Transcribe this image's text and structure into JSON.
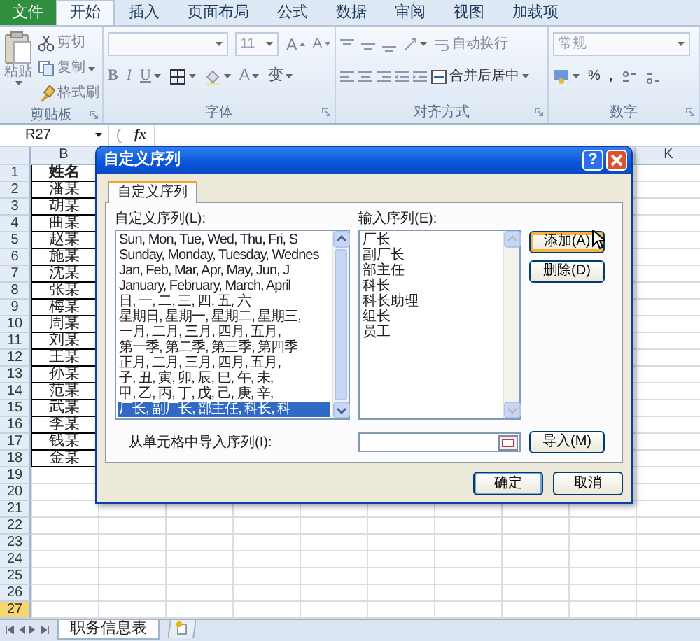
{
  "ribbon_tabs": [
    {
      "label": "文件",
      "kind": "file",
      "selected": false
    },
    {
      "label": "开始",
      "kind": "tab",
      "selected": true
    },
    {
      "label": "插入",
      "kind": "tab",
      "selected": false
    },
    {
      "label": "页面布局",
      "kind": "tab",
      "selected": false
    },
    {
      "label": "公式",
      "kind": "tab",
      "selected": false
    },
    {
      "label": "数据",
      "kind": "tab",
      "selected": false
    },
    {
      "label": "审阅",
      "kind": "tab",
      "selected": false
    },
    {
      "label": "视图",
      "kind": "tab",
      "selected": false
    },
    {
      "label": "加载项",
      "kind": "tab",
      "selected": false
    }
  ],
  "ribbon": {
    "clipboard": {
      "paste": "粘贴",
      "cut": "剪切",
      "copy": "复制",
      "format_painter": "格式刷",
      "label": "剪贴板"
    },
    "font": {
      "size": "11",
      "grow": "A",
      "shrink": "A",
      "bold": "B",
      "italic": "I",
      "underline": "U",
      "font_color": "A",
      "phonetic": "变",
      "label": "字体"
    },
    "alignment": {
      "wrap_text": "自动换行",
      "merge_center": "合并后居中",
      "label": "对齐方式"
    },
    "number": {
      "format": "常规",
      "percent": "%",
      "comma": ",",
      "label": "数字"
    }
  },
  "formula_bar": {
    "name_box": "R27",
    "fx": "fx"
  },
  "sheet": {
    "columns": [
      {
        "label": "B"
      },
      {},
      {},
      {},
      {},
      {},
      {},
      {},
      {},
      {
        "label": "K"
      }
    ],
    "rows": [
      {
        "number": "1",
        "kind": "header",
        "name": "姓名",
        "selected": false
      },
      {
        "number": "2",
        "kind": "entry",
        "name": "潘某",
        "selected": false
      },
      {
        "number": "3",
        "kind": "entry",
        "name": "胡某",
        "selected": false
      },
      {
        "number": "4",
        "kind": "entry",
        "name": "曲某",
        "selected": false
      },
      {
        "number": "5",
        "kind": "entry",
        "name": "赵某",
        "selected": false
      },
      {
        "number": "6",
        "kind": "entry",
        "name": "施某",
        "selected": false
      },
      {
        "number": "7",
        "kind": "entry",
        "name": "沈某",
        "selected": false
      },
      {
        "number": "8",
        "kind": "entry",
        "name": "张某",
        "selected": false
      },
      {
        "number": "9",
        "kind": "entry",
        "name": "梅某",
        "selected": false
      },
      {
        "number": "10",
        "kind": "entry",
        "name": "周某",
        "selected": false
      },
      {
        "number": "11",
        "kind": "entry",
        "name": "刘某",
        "selected": false
      },
      {
        "number": "12",
        "kind": "entry",
        "name": "王某",
        "selected": false
      },
      {
        "number": "13",
        "kind": "entry",
        "name": "孙某",
        "selected": false
      },
      {
        "number": "14",
        "kind": "entry",
        "name": "范某",
        "selected": false
      },
      {
        "number": "15",
        "kind": "entry",
        "name": "武某",
        "selected": false
      },
      {
        "number": "16",
        "kind": "entry",
        "name": "李某",
        "selected": false
      },
      {
        "number": "17",
        "kind": "entry",
        "name": "钱某",
        "selected": false
      },
      {
        "number": "18",
        "kind": "entry",
        "name": "金某",
        "selected": false
      },
      {
        "number": "19",
        "kind": "empty",
        "selected": false
      },
      {
        "number": "20",
        "kind": "empty",
        "selected": false
      },
      {
        "number": "21",
        "kind": "empty",
        "selected": false
      },
      {
        "number": "22",
        "kind": "empty",
        "selected": false
      },
      {
        "number": "23",
        "kind": "empty",
        "selected": false
      },
      {
        "number": "24",
        "kind": "empty",
        "selected": false
      },
      {
        "number": "25",
        "kind": "empty",
        "selected": false
      },
      {
        "number": "26",
        "kind": "empty",
        "selected": false
      },
      {
        "number": "27",
        "kind": "empty",
        "selected": true
      }
    ]
  },
  "dialog": {
    "title": "自定义序列",
    "help": "?",
    "tabs": [
      {
        "label": "自定义序列",
        "selected": true
      }
    ],
    "list_label": "自定义序列(L):",
    "list_items": [
      {
        "text": "Sun, Mon, Tue, Wed, Thu, Fri, S",
        "selected": false
      },
      {
        "text": "Sunday, Monday, Tuesday, Wednes",
        "selected": false
      },
      {
        "text": "Jan, Feb, Mar, Apr, May, Jun, J",
        "selected": false
      },
      {
        "text": "January, February, March, April",
        "selected": false
      },
      {
        "text": "日, 一, 二, 三, 四, 五, 六",
        "selected": false
      },
      {
        "text": "星期日, 星期一, 星期二, 星期三,",
        "selected": false
      },
      {
        "text": "一月, 二月, 三月, 四月, 五月,",
        "selected": false
      },
      {
        "text": "第一季, 第二季, 第三季, 第四季",
        "selected": false
      },
      {
        "text": "正月, 二月, 三月, 四月, 五月,",
        "selected": false
      },
      {
        "text": "子, 丑, 寅, 卯, 辰, 巳, 午, 未,",
        "selected": false
      },
      {
        "text": "甲, 乙, 丙, 丁, 戊, 己, 庚, 辛,",
        "selected": false
      },
      {
        "text": "厂长, 副厂长, 部主任, 科长, 科",
        "selected": true
      }
    ],
    "entries_label": "输入序列(E):",
    "entries": [
      "厂长",
      "副厂长",
      "部主任",
      "科长",
      "科长助理",
      "组长",
      "员工"
    ],
    "add_button": {
      "label": "添加(A)",
      "hovered": true
    },
    "delete_button": {
      "label": "删除(D)",
      "hovered": false
    },
    "import_label": "从单元格中导入序列(I):",
    "import_button": "导入(M)",
    "ok": "确定",
    "cancel": "取消"
  },
  "sheet_tabs": [
    {
      "label": "职务信息表",
      "selected": true
    }
  ]
}
